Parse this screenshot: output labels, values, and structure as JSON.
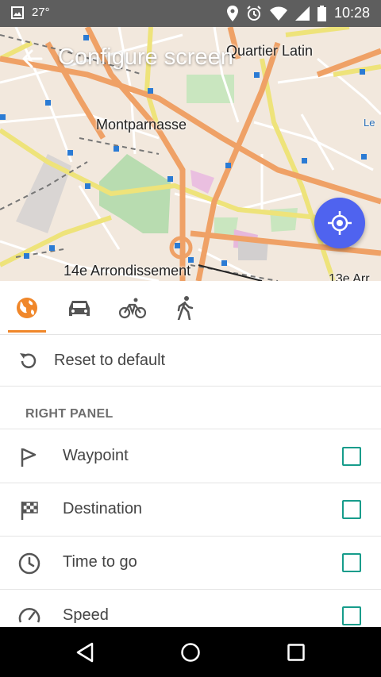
{
  "status_bar": {
    "temperature": "27°",
    "time": "10:28",
    "icons": [
      "image-icon",
      "location-icon",
      "alarm-icon",
      "wifi-icon",
      "signal-icon",
      "battery-icon"
    ]
  },
  "app_bar": {
    "title": "Configure screen",
    "back_icon": "back-arrow-icon"
  },
  "map": {
    "labels": {
      "quartier": "Quartier Latin",
      "montparnasse": "Montparnasse",
      "arrondissement": "14e Arrondissement",
      "corner_right": "13e Arr",
      "le": "Le"
    },
    "fab_icon": "my-location-icon",
    "fab_color": "#4f63ef"
  },
  "tabs": [
    {
      "name": "browse-map",
      "icon": "globe-icon",
      "selected": true
    },
    {
      "name": "car",
      "icon": "car-icon",
      "selected": false
    },
    {
      "name": "bicycle",
      "icon": "bicycle-icon",
      "selected": false
    },
    {
      "name": "pedestrian",
      "icon": "walk-icon",
      "selected": false
    }
  ],
  "accent_color": "#f0872a",
  "checkbox_color": "#169c8b",
  "reset": {
    "label": "Reset to default",
    "icon": "reset-icon"
  },
  "section": {
    "title": "RIGHT PANEL"
  },
  "items": [
    {
      "label": "Waypoint",
      "icon": "flag-icon",
      "checked": false
    },
    {
      "label": "Destination",
      "icon": "checkered-flag-icon",
      "checked": false
    },
    {
      "label": "Time to go",
      "icon": "clock-icon",
      "checked": false
    },
    {
      "label": "Speed",
      "icon": "speedometer-icon",
      "checked": false
    }
  ],
  "nav_bar": [
    "back-triangle-icon",
    "home-circle-icon",
    "recents-square-icon"
  ]
}
